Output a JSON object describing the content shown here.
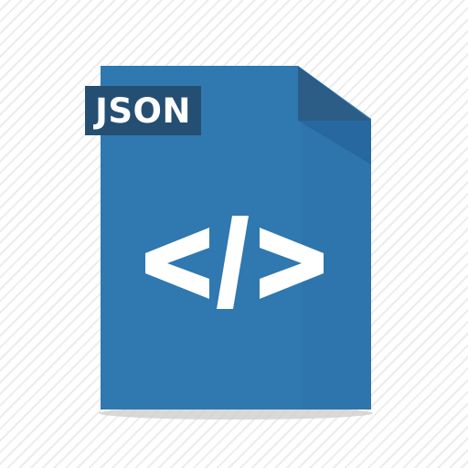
{
  "file_icon": {
    "format_label": "JSON",
    "symbol_icon": "code-brackets-icon",
    "colors": {
      "page": "#2f78b0",
      "page_shade": "#2a6da2",
      "fold": "#2b5d87",
      "fold_shadow": "#2768a0",
      "label_bg": "#254f72",
      "label_text": "#ffffff",
      "symbol": "#ffffff",
      "base_shadow": "#d0d0d0"
    }
  }
}
